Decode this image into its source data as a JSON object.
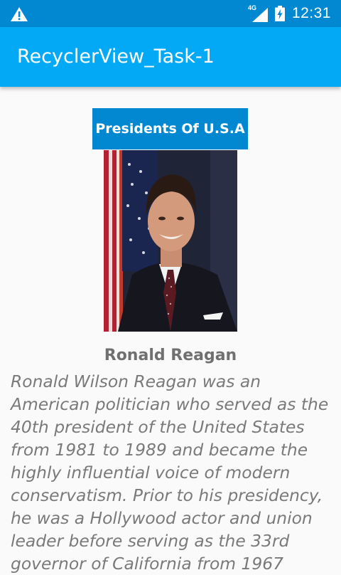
{
  "status_bar": {
    "network": "4G",
    "time": "12:31",
    "icons": [
      "warning-icon",
      "signal-icon",
      "battery-charging-icon"
    ]
  },
  "app_bar": {
    "title": "RecyclerView_Task-1"
  },
  "content": {
    "header_button": "Presidents Of U.S.A",
    "president": {
      "name": "Ronald Reagan",
      "description": "Ronald Wilson Reagan was an American politician who served as the 40th president of the United States from 1981 to 1989 and became the highly influential voice of modern conservatism. Prior to his presidency, he was a Hollywood actor and union leader before serving as the 33rd governor of California from 1967"
    }
  },
  "colors": {
    "status_bar": "#0288d1",
    "app_bar": "#03a9f4",
    "button": "#0288d1",
    "background": "#fafafa",
    "text_gray": "#707070"
  }
}
